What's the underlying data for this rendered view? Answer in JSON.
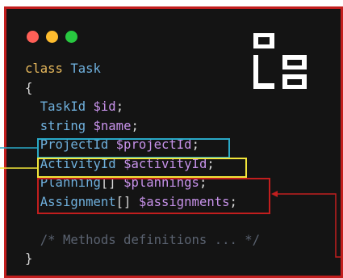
{
  "window": {
    "controls": [
      "close-dot",
      "minimize-dot",
      "maximize-dot"
    ]
  },
  "code": {
    "lines": [
      [
        {
          "t": "class",
          "c": "kw"
        },
        {
          "t": " ",
          "c": "pun"
        },
        {
          "t": "Task",
          "c": "cls"
        }
      ],
      [
        {
          "t": "{",
          "c": "pun"
        }
      ],
      [
        {
          "t": "  ",
          "c": "pun"
        },
        {
          "t": "TaskId",
          "c": "ty"
        },
        {
          "t": " ",
          "c": "pun"
        },
        {
          "t": "$id",
          "c": "var"
        },
        {
          "t": ";",
          "c": "pun"
        }
      ],
      [
        {
          "t": "  ",
          "c": "pun"
        },
        {
          "t": "string",
          "c": "ty"
        },
        {
          "t": " ",
          "c": "pun"
        },
        {
          "t": "$name",
          "c": "var"
        },
        {
          "t": ";",
          "c": "pun"
        }
      ],
      [
        {
          "t": "  ",
          "c": "pun"
        },
        {
          "t": "ProjectId",
          "c": "ty"
        },
        {
          "t": " ",
          "c": "pun"
        },
        {
          "t": "$projectId",
          "c": "var"
        },
        {
          "t": ";",
          "c": "pun"
        }
      ],
      [
        {
          "t": "  ",
          "c": "pun"
        },
        {
          "t": "ActivityId",
          "c": "ty"
        },
        {
          "t": " ",
          "c": "pun"
        },
        {
          "t": "$activityId",
          "c": "var"
        },
        {
          "t": ";",
          "c": "pun"
        }
      ],
      [
        {
          "t": "  ",
          "c": "pun"
        },
        {
          "t": "Planning",
          "c": "ty"
        },
        {
          "t": "[]",
          "c": "pun"
        },
        {
          "t": " ",
          "c": "pun"
        },
        {
          "t": "$plannings",
          "c": "var"
        },
        {
          "t": ";",
          "c": "pun"
        }
      ],
      [
        {
          "t": "  ",
          "c": "pun"
        },
        {
          "t": "Assignment",
          "c": "ty"
        },
        {
          "t": "[]",
          "c": "pun"
        },
        {
          "t": " ",
          "c": "pun"
        },
        {
          "t": "$assignments",
          "c": "var"
        },
        {
          "t": ";",
          "c": "pun"
        }
      ],
      [],
      [
        {
          "t": "  ",
          "c": "pun"
        },
        {
          "t": "/* Methods definitions ... */",
          "c": "cm"
        }
      ],
      [
        {
          "t": "}",
          "c": "pun"
        }
      ]
    ]
  },
  "colors": {
    "frame_border": "#c21e1e",
    "background": "#141414",
    "highlight_cyan": "#2aa9c7",
    "highlight_yellow": "#f2e63a",
    "highlight_red": "#c21e1e"
  }
}
